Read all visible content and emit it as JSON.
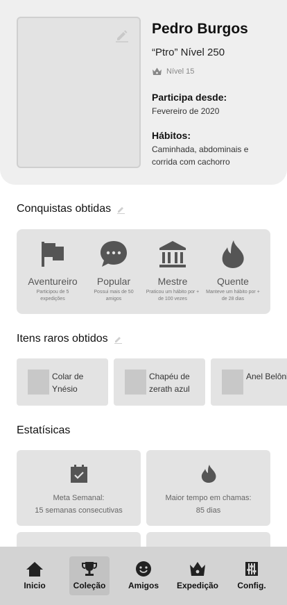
{
  "profile": {
    "name": "Pedro Burgos",
    "nickname_line": "“Ptro”  Nível 250",
    "level": "Nível 15",
    "since_title": "Participa desde:",
    "since_value": "Fevereiro de 2020",
    "habits_title": "Hábitos:",
    "habits_value": "Caminhada, abdominais e corrida com cachorro"
  },
  "achievements": {
    "title": "Conquistas obtidas",
    "items": [
      {
        "name": "Aventureiro",
        "desc": "Participou de 5 expedições",
        "icon": "flag-icon"
      },
      {
        "name": "Popular",
        "desc": "Possui mais de 50 amigos",
        "icon": "chat-bubble-icon"
      },
      {
        "name": "Mestre",
        "desc": "Praticou um hábito por + de 100 vezes",
        "icon": "temple-icon"
      },
      {
        "name": "Quente",
        "desc": "Manteve um hábito por + de 28 dias",
        "icon": "flame-icon"
      }
    ]
  },
  "rare_items": {
    "title": "Itens raros obtidos",
    "items": [
      {
        "name": "Colar de Ynésio"
      },
      {
        "name": "Chapéu de zerath azul"
      },
      {
        "name": "Anel Belônio"
      }
    ]
  },
  "stats": {
    "title": "Estatísicas",
    "items": [
      {
        "label_line1": "Meta Semanal:",
        "label_line2": "15 semanas consecutivas",
        "icon": "calendar-check-icon"
      },
      {
        "label_line1": "Maior tempo em chamas:",
        "label_line2": "85 dias",
        "icon": "flame-icon"
      }
    ]
  },
  "nav": {
    "items": [
      {
        "label": "Inicio",
        "icon": "home-icon",
        "active": false
      },
      {
        "label": "Coleção",
        "icon": "trophy-icon",
        "active": true
      },
      {
        "label": "Amigos",
        "icon": "smiley-icon",
        "active": false
      },
      {
        "label": "Expedição",
        "icon": "crown-icon",
        "active": false
      },
      {
        "label": "Config.",
        "icon": "sliders-icon",
        "active": false
      }
    ]
  },
  "colors": {
    "card_bg": "#efefef",
    "tile_bg": "#e3e3e3",
    "nav_bg": "#d3d3d3",
    "nav_active": "#c2c2c2",
    "icon": "#555555"
  }
}
